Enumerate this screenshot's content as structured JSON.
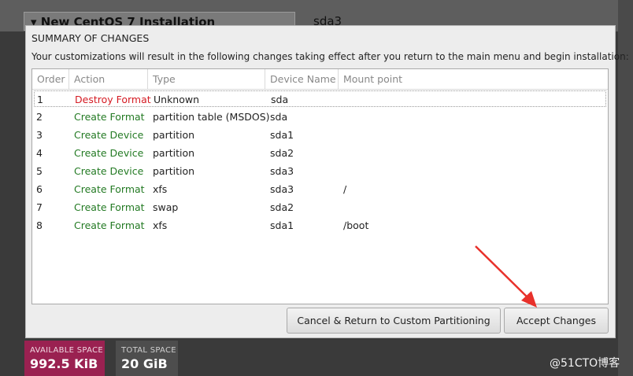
{
  "background": {
    "installation_title": "New CentOS 7 Installation",
    "device_label": "sda3"
  },
  "dialog": {
    "title": "SUMMARY OF CHANGES",
    "description": "Your customizations will result in the following changes taking effect after you return to the main menu and begin installation:",
    "columns": [
      "Order",
      "Action",
      "Type",
      "Device Name",
      "Mount point"
    ],
    "rows": [
      {
        "order": "1",
        "action": "Destroy Format",
        "type": "Unknown",
        "device": "sda",
        "mount": ""
      },
      {
        "order": "2",
        "action": "Create Format",
        "type": "partition table (MSDOS)",
        "device": "sda",
        "mount": ""
      },
      {
        "order": "3",
        "action": "Create Device",
        "type": "partition",
        "device": "sda1",
        "mount": ""
      },
      {
        "order": "4",
        "action": "Create Device",
        "type": "partition",
        "device": "sda2",
        "mount": ""
      },
      {
        "order": "5",
        "action": "Create Device",
        "type": "partition",
        "device": "sda3",
        "mount": ""
      },
      {
        "order": "6",
        "action": "Create Format",
        "type": "xfs",
        "device": "sda3",
        "mount": "/"
      },
      {
        "order": "7",
        "action": "Create Format",
        "type": "swap",
        "device": "sda2",
        "mount": ""
      },
      {
        "order": "8",
        "action": "Create Format",
        "type": "xfs",
        "device": "sda1",
        "mount": "/boot"
      }
    ],
    "cancel_label": "Cancel & Return to Custom Partitioning",
    "accept_label": "Accept Changes"
  },
  "space": {
    "available_label": "AVAILABLE SPACE",
    "available_value": "992.5 KiB",
    "total_label": "TOTAL SPACE",
    "total_value": "20 GiB"
  },
  "watermark": "@51CTO博客",
  "colors": {
    "destroy": "#d51b23",
    "create": "#237a23",
    "available_bg": "#9a2151",
    "arrow": "#e8312b"
  }
}
